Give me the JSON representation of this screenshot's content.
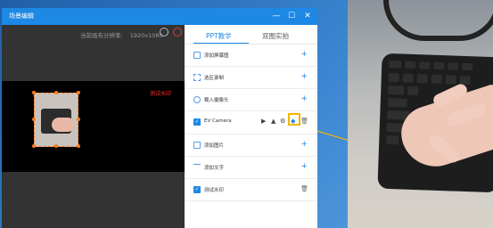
{
  "window": {
    "title": "场景编辑",
    "controls": {
      "minimize": "—",
      "maximize": "☐",
      "close": "✕"
    }
  },
  "preview": {
    "resolution_label": "当前画布分辨率:",
    "resolution_value": "1920x1080",
    "watermark_text": "测试水印"
  },
  "tabs": [
    {
      "label": "PPT教学",
      "active": true
    },
    {
      "label": "双图实拍",
      "active": false
    }
  ],
  "rows": [
    {
      "label": "添加屏幕图",
      "icon": "monitor-icon",
      "action": "+"
    },
    {
      "label": "选区录制",
      "icon": "region-select-icon",
      "action": "+"
    },
    {
      "label": "载入摄像头",
      "icon": "camera-icon",
      "action": "+"
    },
    {
      "label": "EV Camera",
      "icon": "checkbox-checked-icon",
      "action": "tools"
    },
    {
      "label": "添加图片",
      "icon": "image-icon",
      "action": "+"
    },
    {
      "label": "添加文字",
      "icon": "text-icon",
      "action": "+"
    },
    {
      "label": "测试水印",
      "icon": "checkbox-checked-icon",
      "action": "trash"
    }
  ],
  "row_tools": {
    "camera_icon": "▶",
    "mountain_icon": "▲",
    "settings_icon": "⚙",
    "shield_icon": "◆",
    "trash_icon": "🗑"
  },
  "colors": {
    "accent": "#1e88e5",
    "highlight": "#f4b400",
    "selection": "#ff7a1a",
    "watermark": "#ff2a2a"
  }
}
